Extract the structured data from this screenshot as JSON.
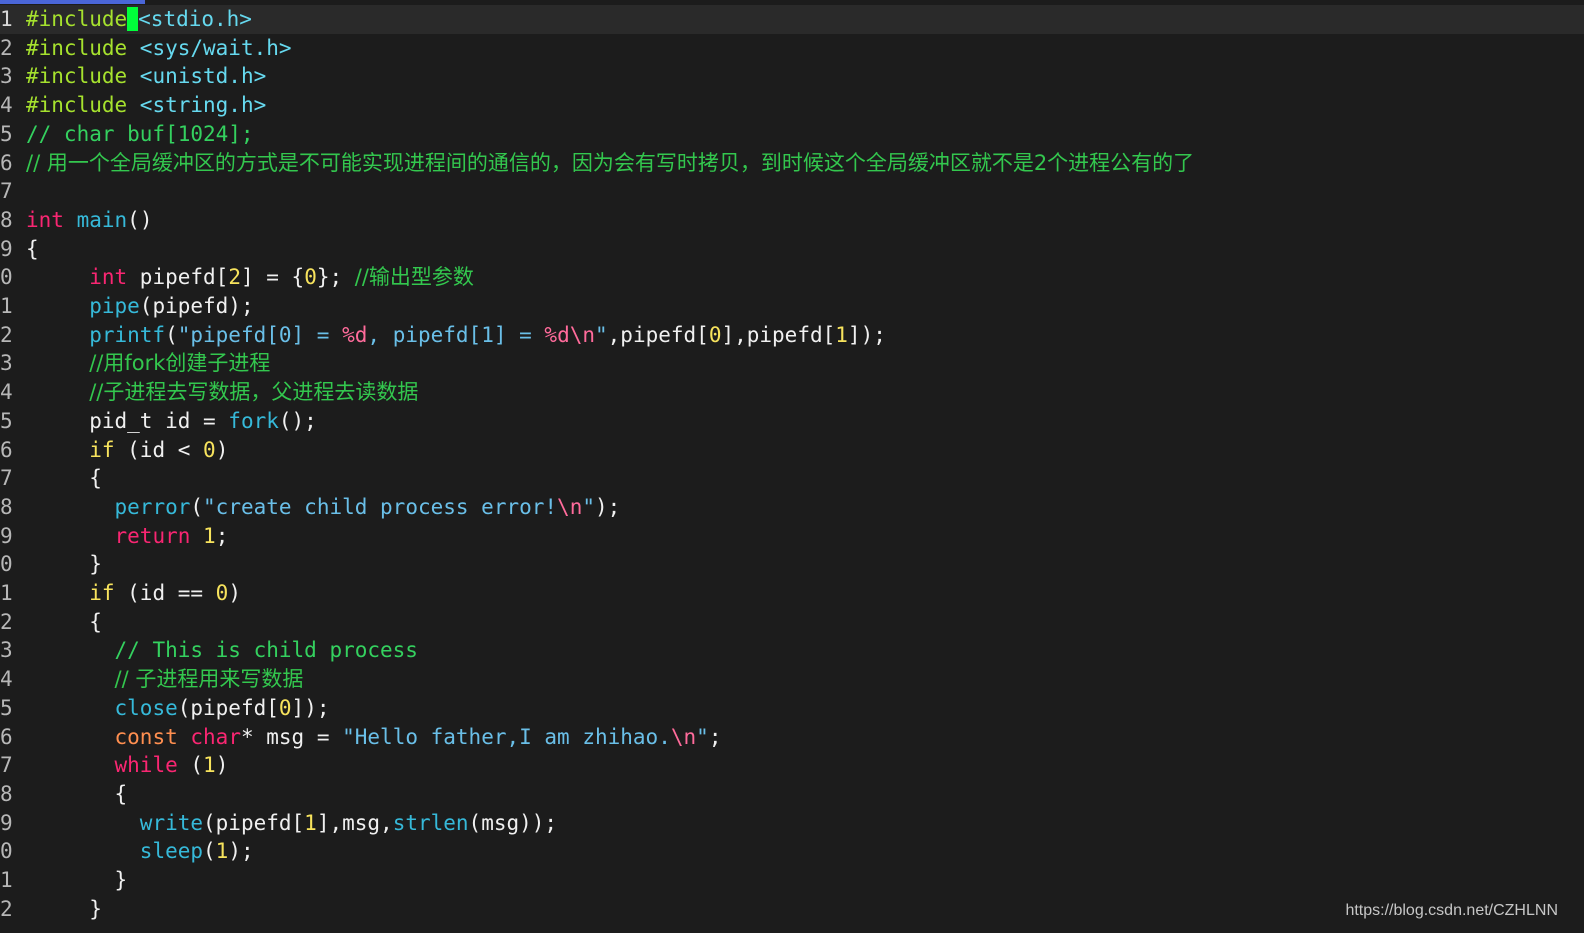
{
  "editor": {
    "lines": [
      {
        "num": "1",
        "tokens": [
          {
            "t": "#include",
            "c": "pre"
          },
          {
            "t": "<stdio.h>",
            "c": "inc"
          }
        ]
      },
      {
        "num": "2",
        "tokens": [
          {
            "t": "#include ",
            "c": "pre"
          },
          {
            "t": "<sys/wait.h>",
            "c": "inc"
          }
        ]
      },
      {
        "num": "3",
        "tokens": [
          {
            "t": "#include ",
            "c": "pre"
          },
          {
            "t": "<unistd.h>",
            "c": "inc"
          }
        ]
      },
      {
        "num": "4",
        "tokens": [
          {
            "t": "#include ",
            "c": "pre"
          },
          {
            "t": "<string.h>",
            "c": "inc"
          }
        ]
      },
      {
        "num": "5",
        "tokens": [
          {
            "t": "// char buf[1024];",
            "c": "comment"
          }
        ]
      },
      {
        "num": "6",
        "tokens": [
          {
            "t": "// 用一个全局缓冲区的方式是不可能实现进程间的通信的，因为会有写时拷贝，到时候这个全局缓冲区就不是2个进程公有的了",
            "c": "comment"
          }
        ]
      },
      {
        "num": "7",
        "tokens": []
      },
      {
        "num": "8",
        "tokens": [
          {
            "t": "int",
            "c": "type"
          },
          {
            "t": " ",
            "c": "default"
          },
          {
            "t": "main",
            "c": "func"
          },
          {
            "t": "()",
            "c": "default"
          }
        ]
      },
      {
        "num": "9",
        "tokens": [
          {
            "t": "{",
            "c": "default"
          }
        ]
      },
      {
        "num": "0",
        "tokens": [
          {
            "t": "     ",
            "c": "default"
          },
          {
            "t": "int",
            "c": "type"
          },
          {
            "t": " pipefd[",
            "c": "default"
          },
          {
            "t": "2",
            "c": "num"
          },
          {
            "t": "] = {",
            "c": "default"
          },
          {
            "t": "0",
            "c": "num"
          },
          {
            "t": "}; ",
            "c": "default"
          },
          {
            "t": "//输出型参数",
            "c": "comment"
          }
        ]
      },
      {
        "num": "1",
        "tokens": [
          {
            "t": "     ",
            "c": "default"
          },
          {
            "t": "pipe",
            "c": "func"
          },
          {
            "t": "(pipefd);",
            "c": "default"
          }
        ]
      },
      {
        "num": "2",
        "tokens": [
          {
            "t": "     ",
            "c": "default"
          },
          {
            "t": "printf",
            "c": "func"
          },
          {
            "t": "(",
            "c": "default"
          },
          {
            "t": "\"pipefd[0] = ",
            "c": "string"
          },
          {
            "t": "%d",
            "c": "esc"
          },
          {
            "t": ", pipefd[1] = ",
            "c": "string"
          },
          {
            "t": "%d\\n",
            "c": "esc"
          },
          {
            "t": "\"",
            "c": "string"
          },
          {
            "t": ",pipefd[",
            "c": "default"
          },
          {
            "t": "0",
            "c": "num"
          },
          {
            "t": "],pipefd[",
            "c": "default"
          },
          {
            "t": "1",
            "c": "num"
          },
          {
            "t": "]);",
            "c": "default"
          }
        ]
      },
      {
        "num": "3",
        "tokens": [
          {
            "t": "     ",
            "c": "default"
          },
          {
            "t": "//用fork创建子进程",
            "c": "comment"
          }
        ]
      },
      {
        "num": "4",
        "tokens": [
          {
            "t": "     ",
            "c": "default"
          },
          {
            "t": "//子进程去写数据，父进程去读数据",
            "c": "comment"
          }
        ]
      },
      {
        "num": "5",
        "tokens": [
          {
            "t": "     pid_t id = ",
            "c": "default"
          },
          {
            "t": "fork",
            "c": "func"
          },
          {
            "t": "();",
            "c": "default"
          }
        ]
      },
      {
        "num": "6",
        "tokens": [
          {
            "t": "     ",
            "c": "default"
          },
          {
            "t": "if",
            "c": "key"
          },
          {
            "t": " (id < ",
            "c": "default"
          },
          {
            "t": "0",
            "c": "num"
          },
          {
            "t": ")",
            "c": "default"
          }
        ]
      },
      {
        "num": "7",
        "tokens": [
          {
            "t": "     {",
            "c": "default"
          }
        ]
      },
      {
        "num": "8",
        "tokens": [
          {
            "t": "       ",
            "c": "default"
          },
          {
            "t": "perror",
            "c": "func"
          },
          {
            "t": "(",
            "c": "default"
          },
          {
            "t": "\"create child process error!",
            "c": "string"
          },
          {
            "t": "\\n",
            "c": "esc"
          },
          {
            "t": "\"",
            "c": "string"
          },
          {
            "t": ");",
            "c": "default"
          }
        ]
      },
      {
        "num": "9",
        "tokens": [
          {
            "t": "       ",
            "c": "default"
          },
          {
            "t": "return",
            "c": "type"
          },
          {
            "t": " ",
            "c": "default"
          },
          {
            "t": "1",
            "c": "num"
          },
          {
            "t": ";",
            "c": "default"
          }
        ]
      },
      {
        "num": "0",
        "tokens": [
          {
            "t": "     }",
            "c": "default"
          }
        ]
      },
      {
        "num": "1",
        "tokens": [
          {
            "t": "     ",
            "c": "default"
          },
          {
            "t": "if",
            "c": "key"
          },
          {
            "t": " (id == ",
            "c": "default"
          },
          {
            "t": "0",
            "c": "num"
          },
          {
            "t": ")",
            "c": "default"
          }
        ]
      },
      {
        "num": "2",
        "tokens": [
          {
            "t": "     {",
            "c": "default"
          }
        ]
      },
      {
        "num": "3",
        "tokens": [
          {
            "t": "       ",
            "c": "default"
          },
          {
            "t": "// This is child process",
            "c": "comment"
          }
        ]
      },
      {
        "num": "4",
        "tokens": [
          {
            "t": "       ",
            "c": "default"
          },
          {
            "t": "// 子进程用来写数据",
            "c": "comment"
          }
        ]
      },
      {
        "num": "5",
        "tokens": [
          {
            "t": "       ",
            "c": "default"
          },
          {
            "t": "close",
            "c": "func"
          },
          {
            "t": "(pipefd[",
            "c": "default"
          },
          {
            "t": "0",
            "c": "num"
          },
          {
            "t": "]);",
            "c": "default"
          }
        ]
      },
      {
        "num": "6",
        "tokens": [
          {
            "t": "       ",
            "c": "default"
          },
          {
            "t": "const",
            "c": "orange"
          },
          {
            "t": " ",
            "c": "default"
          },
          {
            "t": "char",
            "c": "type"
          },
          {
            "t": "* msg = ",
            "c": "default"
          },
          {
            "t": "\"Hello father,I am zhihao.",
            "c": "string"
          },
          {
            "t": "\\n",
            "c": "esc"
          },
          {
            "t": "\"",
            "c": "string"
          },
          {
            "t": ";",
            "c": "default"
          }
        ]
      },
      {
        "num": "7",
        "tokens": [
          {
            "t": "       ",
            "c": "default"
          },
          {
            "t": "while",
            "c": "type"
          },
          {
            "t": " (",
            "c": "default"
          },
          {
            "t": "1",
            "c": "num"
          },
          {
            "t": ")",
            "c": "default"
          }
        ]
      },
      {
        "num": "8",
        "tokens": [
          {
            "t": "       {",
            "c": "default"
          }
        ]
      },
      {
        "num": "9",
        "tokens": [
          {
            "t": "         ",
            "c": "default"
          },
          {
            "t": "write",
            "c": "func"
          },
          {
            "t": "(pipefd[",
            "c": "default"
          },
          {
            "t": "1",
            "c": "num"
          },
          {
            "t": "],msg,",
            "c": "default"
          },
          {
            "t": "strlen",
            "c": "func"
          },
          {
            "t": "(msg));",
            "c": "default"
          }
        ]
      },
      {
        "num": "0",
        "tokens": [
          {
            "t": "         ",
            "c": "default"
          },
          {
            "t": "sleep",
            "c": "func"
          },
          {
            "t": "(",
            "c": "default"
          },
          {
            "t": "1",
            "c": "num"
          },
          {
            "t": ");",
            "c": "default"
          }
        ]
      },
      {
        "num": "1",
        "tokens": [
          {
            "t": "       }",
            "c": "default"
          }
        ]
      },
      {
        "num": "2",
        "tokens": [
          {
            "t": "     }",
            "c": "default"
          }
        ]
      }
    ]
  },
  "watermark": "https://blog.csdn.net/CZHLNN",
  "colors": {
    "background": "#1c1c1c",
    "cursor": "#00ff3a",
    "tab_indicator": "#4a66d8"
  }
}
